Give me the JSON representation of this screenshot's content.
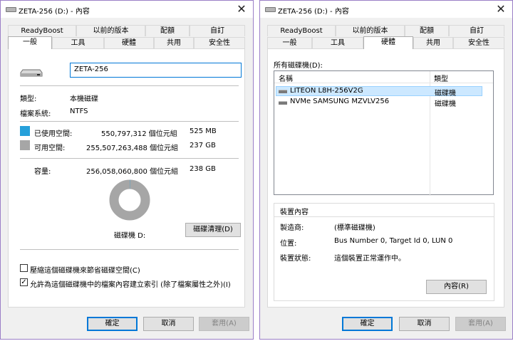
{
  "left": {
    "title": "ZETA-256 (D:) - 內容",
    "tabs_row1": [
      "ReadyBoost",
      "以前的版本",
      "配額",
      "自訂"
    ],
    "tabs_row2": [
      "一般",
      "工具",
      "硬體",
      "共用",
      "安全性"
    ],
    "name_value": "ZETA-256",
    "type_label": "類型:",
    "type_value": "本機磁碟",
    "fs_label": "檔案系統:",
    "fs_value": "NTFS",
    "used_label": "已使用空間:",
    "used_bytes": "550,797,312 個位元組",
    "used_size": "525 MB",
    "free_label": "可用空間:",
    "free_bytes": "255,507,263,488 個位元組",
    "free_size": "237 GB",
    "capacity_label": "容量:",
    "capacity_bytes": "256,058,060,800 個位元組",
    "capacity_size": "238 GB",
    "drive_label": "磁碟機 D:",
    "cleanup_button": "磁碟清理(D)",
    "compress_label": "壓縮這個磁碟機來節省磁碟空間(C)",
    "index_label": "允許為這個磁碟機中的檔案內容建立索引 (除了檔案屬性之外)(I)",
    "ok": "確定",
    "cancel": "取消",
    "apply": "套用(A)",
    "used_color": "#26a0da",
    "free_color": "#a6a6a6"
  },
  "right": {
    "title": "ZETA-256 (D:) - 內容",
    "tabs_row1": [
      "ReadyBoost",
      "以前的版本",
      "配額",
      "自訂"
    ],
    "tabs_row2": [
      "一般",
      "工具",
      "硬體",
      "共用",
      "安全性"
    ],
    "all_drives_label": "所有磁碟機(D):",
    "col_name": "名稱",
    "col_type": "類型",
    "rows": [
      {
        "name": "LITEON L8H-256V2G",
        "type": "磁碟機"
      },
      {
        "name": "NVMe SAMSUNG MZVLV256",
        "type": "磁碟機"
      }
    ],
    "props_group": "裝置內容",
    "manufacturer_label": "製造商:",
    "manufacturer_value": "(標準磁碟機)",
    "location_label": "位置:",
    "location_value": "Bus Number 0, Target Id 0, LUN 0",
    "status_label": "裝置狀態:",
    "status_value": "這個裝置正常運作中。",
    "properties_button": "內容(R)",
    "ok": "確定",
    "cancel": "取消",
    "apply": "套用(A)"
  }
}
